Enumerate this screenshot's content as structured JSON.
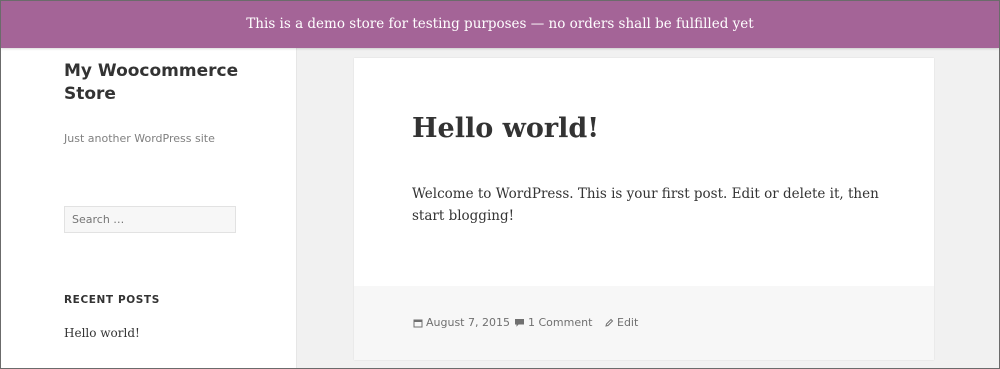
{
  "notice": {
    "text": "This is a demo store for testing purposes — no orders shall be fulfilled yet"
  },
  "sidebar": {
    "site_title": "My Woocommerce Store",
    "site_description": "Just another WordPress site",
    "search_placeholder": "Search …",
    "recent_posts_title": "RECENT POSTS",
    "recent_posts": [
      "Hello world!"
    ]
  },
  "post": {
    "title": "Hello world!",
    "content": "Welcome to WordPress. This is your first post. Edit or delete it, then start blogging!",
    "date": "August 7, 2015",
    "comments": "1 Comment",
    "edit": "Edit"
  },
  "icons": {
    "date": "calendar-icon",
    "comments": "comment-bubble-icon",
    "edit": "pencil-icon"
  },
  "colors": {
    "notice_bg": "#a46497",
    "background": "#f1f1f1",
    "footer_bg": "#f7f7f7"
  }
}
